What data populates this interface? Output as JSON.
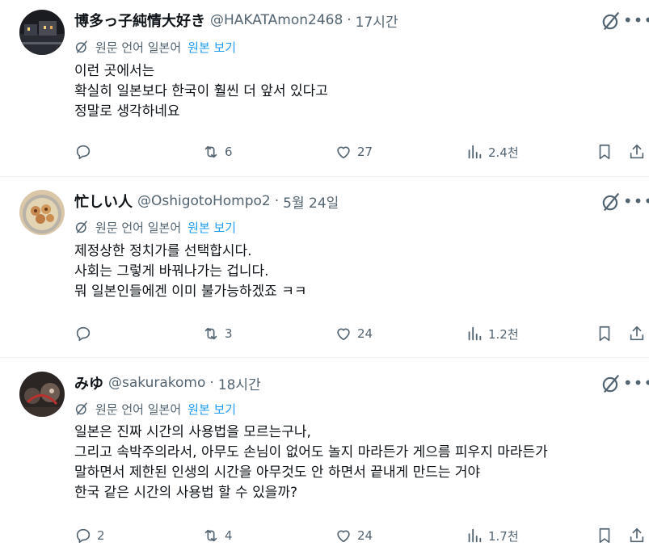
{
  "tweets": [
    {
      "name": "博多っ子純情大好き",
      "handle": "@HAKATAmon2468",
      "separator": "·",
      "time": "17시간",
      "translate_label": "원문 언어 일본어",
      "show_original": "원본 보기",
      "lines": [
        "이런 곳에서는",
        "확실히 일본보다 한국이 훨씬 더 앞서 있다고",
        "정말로 생각하네요"
      ],
      "reply_count": "",
      "retweet_count": "6",
      "like_count": "27",
      "view_count": "2.4천"
    },
    {
      "name": "忙しい人",
      "handle": "@OshigotoHompo2",
      "separator": "·",
      "time": "5월 24일",
      "translate_label": "원문 언어 일본어",
      "show_original": "원본 보기",
      "lines": [
        "제정상한 정치가를 선택합시다.",
        "사회는 그렇게 바꿔나가는 겁니다.",
        "뭐 일본인들에겐 이미 불가능하겠죠 ㅋㅋ"
      ],
      "reply_count": "",
      "retweet_count": "3",
      "like_count": "24",
      "view_count": "1.2천"
    },
    {
      "name": "みゆ",
      "handle": "@sakurakomo",
      "separator": "·",
      "time": "18시간",
      "translate_label": "원문 언어 일본어",
      "show_original": "원본 보기",
      "lines": [
        "일본은 진짜 시간의 사용법을 모르는구나,",
        "그리고 속박주의라서, 아무도 손님이 없어도 놀지 마라든가 게으름 피우지 마라든가",
        "말하면서 제한된 인생의 시간을 아무것도 안 하면서 끝내게 만드는 거야",
        "한국 같은 시간의 사용법 할 수 있을까?"
      ],
      "reply_count": "2",
      "retweet_count": "4",
      "like_count": "24",
      "view_count": "1.7천"
    }
  ],
  "icons": {
    "more": "more-icon",
    "grok": "grok-icon",
    "translate": "translate-icon",
    "reply": "reply-icon",
    "retweet": "retweet-icon",
    "like": "like-icon",
    "views": "views-icon",
    "bookmark": "bookmark-icon",
    "share": "share-icon"
  },
  "colors": {
    "text": "#0f1419",
    "secondary": "#536471",
    "link": "#1d9bf0",
    "divider": "#eff3f4"
  }
}
